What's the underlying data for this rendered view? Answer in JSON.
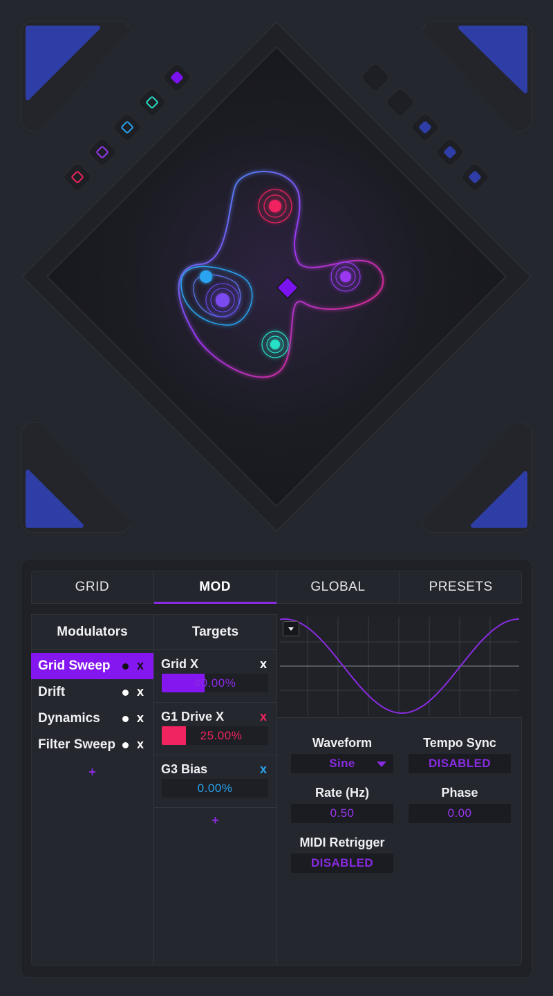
{
  "stage": {
    "corner_color": "#2f3ea6",
    "left_pads": [
      {
        "color": "#7b12f0",
        "style": "filled"
      },
      {
        "color": "#27e0c8",
        "style": "outline"
      },
      {
        "color": "#2aa4f0",
        "style": "outline"
      },
      {
        "color": "#9a37f0",
        "style": "outline"
      },
      {
        "color": "#f0245e",
        "style": "outline"
      }
    ],
    "right_pads": [
      {
        "color": "",
        "style": "empty"
      },
      {
        "color": "",
        "style": "empty"
      },
      {
        "color": "#2f3ea6",
        "style": "filled"
      },
      {
        "color": "#2f3ea6",
        "style": "filled"
      },
      {
        "color": "#2f3ea6",
        "style": "filled"
      }
    ],
    "nodes": [
      {
        "color": "#f0245e"
      },
      {
        "color": "#9a37f0"
      },
      {
        "color": "#27e0c8"
      },
      {
        "color": "#2aa4f0"
      },
      {
        "color": "#7b4bf0"
      }
    ],
    "cursor_color": "#7b12f0"
  },
  "tabs": [
    {
      "label": "GRID",
      "active": false
    },
    {
      "label": "MOD",
      "active": true
    },
    {
      "label": "GLOBAL",
      "active": false
    },
    {
      "label": "PRESETS",
      "active": false
    }
  ],
  "modulators": {
    "title": "Modulators",
    "items": [
      {
        "label": "Grid Sweep",
        "remove": "x",
        "active": true
      },
      {
        "label": "Drift",
        "remove": "x",
        "active": false
      },
      {
        "label": "Dynamics",
        "remove": "x",
        "active": false
      },
      {
        "label": "Filter Sweep",
        "remove": "x",
        "active": false
      }
    ],
    "add": "+"
  },
  "targets": {
    "title": "Targets",
    "items": [
      {
        "name": "Grid X",
        "remove": "x",
        "value_text": "40.00%",
        "amount": 0.4,
        "color": "#8416f0",
        "x_color": "#ffffff"
      },
      {
        "name": "G1 Drive X",
        "remove": "x",
        "value_text": "25.00%",
        "amount": 0.25,
        "color": "#f0245e",
        "x_color": "#f0245e"
      },
      {
        "name": "G3 Bias",
        "remove": "x",
        "value_text": "0.00%",
        "amount": 0.0,
        "color": "#2aa4f0",
        "x_color": "#2aa4f0"
      }
    ],
    "add": "+"
  },
  "lfo": {
    "waveform_label": "Waveform",
    "waveform_value": "Sine",
    "tempo_sync_label": "Tempo Sync",
    "tempo_sync_value": "DISABLED",
    "rate_label": "Rate (Hz)",
    "rate_value": "0.50",
    "phase_label": "Phase",
    "phase_value": "0.00",
    "midi_label": "MIDI Retrigger",
    "midi_value": "DISABLED",
    "wave_color": "#8a2be2"
  }
}
